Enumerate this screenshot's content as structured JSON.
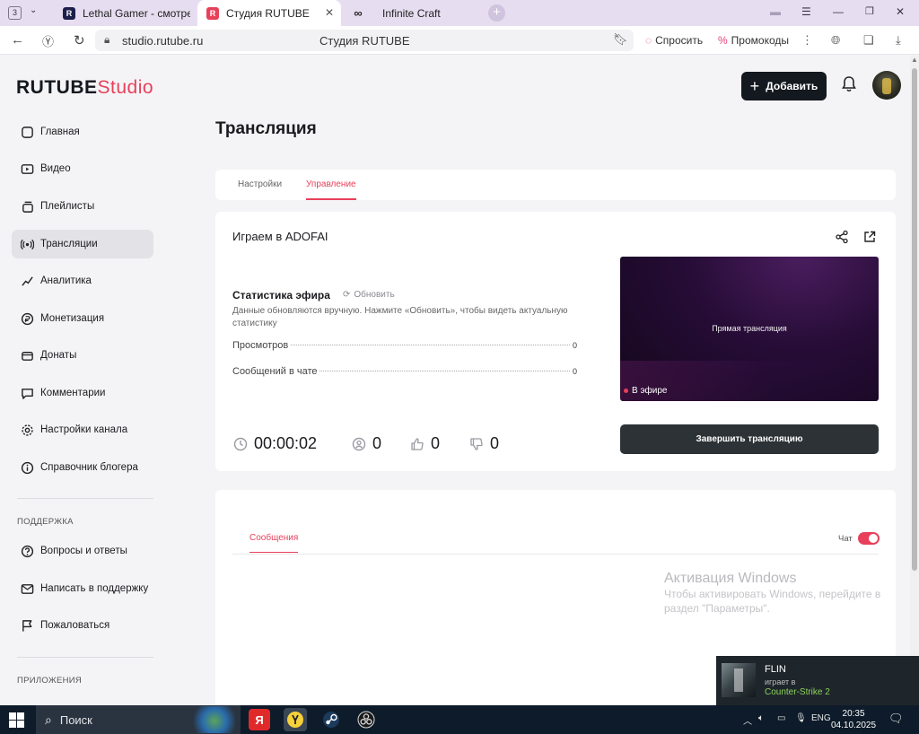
{
  "browser": {
    "tab_count": "3",
    "tabs": [
      {
        "title": "Lethal Gamer - смотреть",
        "favicon": "R"
      },
      {
        "title": "Студия RUTUBE",
        "favicon": "R"
      },
      {
        "title": "Infinite Craft",
        "favicon": "∞"
      }
    ],
    "url": "studio.rutube.ru",
    "page_title": "Студия RUTUBE",
    "ask_label": "Спросить",
    "promo_label": "Промокоды"
  },
  "header": {
    "logo_main": "RUTUBE",
    "logo_studio": "Studio",
    "add_button": "Добавить"
  },
  "sidebar": {
    "items": [
      {
        "label": "Главная",
        "icon": "home-icon"
      },
      {
        "label": "Видео",
        "icon": "video-icon"
      },
      {
        "label": "Плейлисты",
        "icon": "playlist-icon"
      },
      {
        "label": "Трансляции",
        "icon": "broadcast-icon"
      },
      {
        "label": "Аналитика",
        "icon": "analytics-icon"
      },
      {
        "label": "Монетизация",
        "icon": "monetization-icon"
      },
      {
        "label": "Донаты",
        "icon": "donate-icon"
      },
      {
        "label": "Комментарии",
        "icon": "comment-icon"
      },
      {
        "label": "Настройки канала",
        "icon": "settings-icon"
      },
      {
        "label": "Справочник блогера",
        "icon": "info-icon"
      }
    ],
    "support_section": "ПОДДЕРЖКА",
    "support_items": [
      {
        "label": "Вопросы и ответы",
        "icon": "faq-icon"
      },
      {
        "label": "Написать в поддержку",
        "icon": "mail-icon"
      },
      {
        "label": "Пожаловаться",
        "icon": "flag-icon"
      }
    ],
    "apps_section": "ПРИЛОЖЕНИЯ"
  },
  "main": {
    "title": "Трансляция",
    "tabs": [
      "Настройки",
      "Управление"
    ],
    "stream": {
      "name": "Играем в ADOFAI",
      "stats_title": "Статистика эфира",
      "refresh_label": "Обновить",
      "stats_note": "Данные обновляются вручную. Нажмите «Обновить», чтобы видеть актуальную статистику",
      "views_label": "Просмотров",
      "views_value": "0",
      "chat_messages_label": "Сообщений в чате",
      "chat_messages_value": "0",
      "duration": "00:00:02",
      "viewers": "0",
      "likes": "0",
      "dislikes": "0",
      "preview_label": "Прямая трансляция",
      "live_badge": "В эфире",
      "end_button": "Завершить трансляцию"
    },
    "messages": {
      "tab_label": "Сообщения",
      "chat_label": "Чат",
      "chat_enabled": true
    }
  },
  "windows_activation": {
    "title": "Активация Windows",
    "text": "Чтобы активировать Windows, перейдите в раздел \"Параметры\"."
  },
  "notification": {
    "name": "FLIN",
    "status": "играет в",
    "game": "Counter-Strike 2"
  },
  "taskbar": {
    "search_placeholder": "Поиск",
    "language": "ENG",
    "time": "20:35",
    "date": "04.10.2025"
  },
  "colors": {
    "accent": "#e8405a",
    "dark_button": "#14191f",
    "end_button": "#2c3236"
  }
}
